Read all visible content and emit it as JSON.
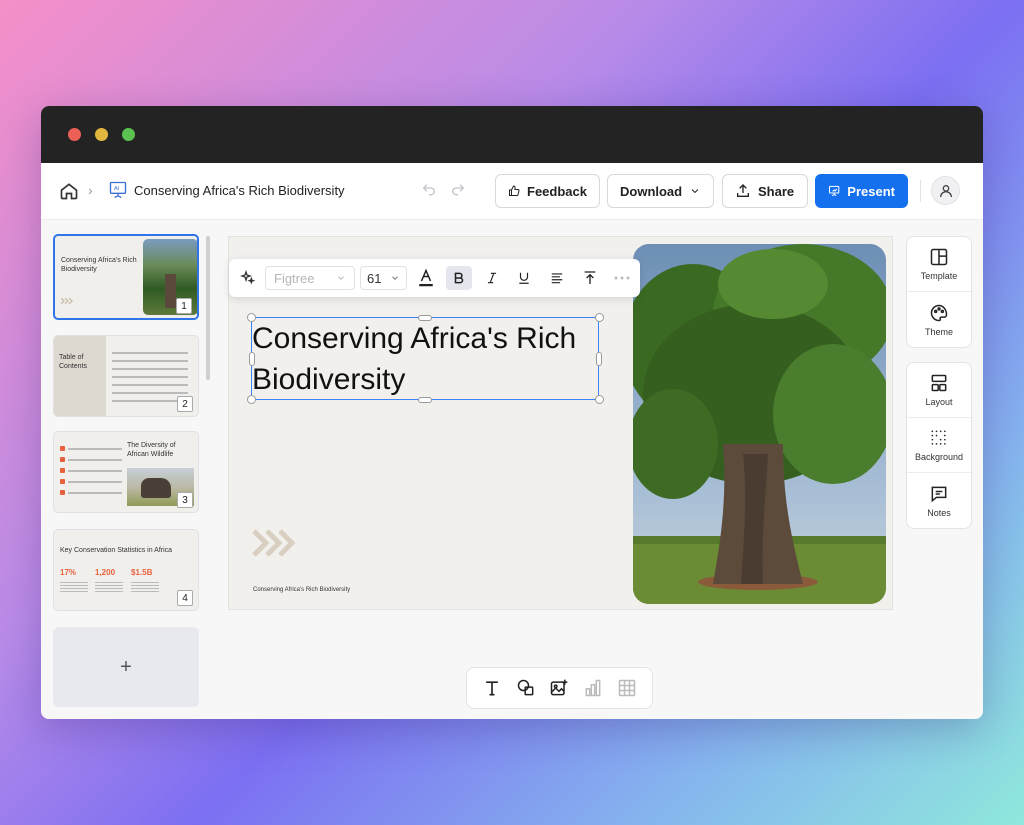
{
  "breadcrumb": {
    "doc_title": "Conserving Africa's Rich Biodiversity"
  },
  "topbar": {
    "feedback_label": "Feedback",
    "download_label": "Download",
    "share_label": "Share",
    "present_label": "Present"
  },
  "slides": [
    {
      "number": "1",
      "title": "Conserving Africa's Rich Biodiversity"
    },
    {
      "number": "2",
      "title": "Table of Contents"
    },
    {
      "number": "3",
      "title": "The Diversity of African Wildlife"
    },
    {
      "number": "4",
      "title": "Key Conservation Statistics in Africa",
      "stats": [
        "17%",
        "1,200",
        "$1.5B"
      ]
    }
  ],
  "add_slide_label": "+",
  "text_toolbar": {
    "font_family_placeholder": "Figtree",
    "font_size": "61"
  },
  "canvas": {
    "title": "Conserving Africa's Rich Biodiversity",
    "footer": "Conserving Africa's Rich Biodiversity"
  },
  "right_panel": {
    "template_label": "Template",
    "theme_label": "Theme",
    "layout_label": "Layout",
    "background_label": "Background",
    "notes_label": "Notes"
  },
  "colors": {
    "accent": "#1570ef",
    "selection": "#3b82f6",
    "stat_orange": "#e8613c"
  }
}
